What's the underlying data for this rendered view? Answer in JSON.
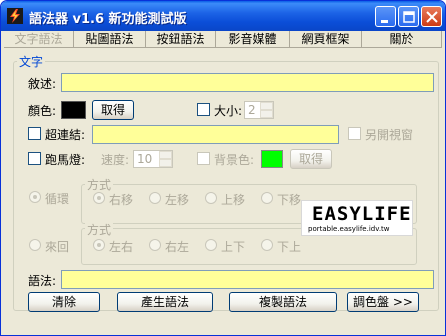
{
  "window": {
    "title": "語法器 v1.6 新功能測試版"
  },
  "menu": [
    {
      "label": "文字語法",
      "active": true
    },
    {
      "label": "貼圖語法"
    },
    {
      "label": "按鈕語法"
    },
    {
      "label": "影音媒體"
    },
    {
      "label": "網頁框架"
    },
    {
      "label": "關於"
    }
  ],
  "section": {
    "legend": "文字"
  },
  "description": {
    "label": "敘述:",
    "value": ""
  },
  "color_row": {
    "label": "顏色:",
    "swatch_color": "#000000",
    "pick_button": "取得",
    "size_label": "大小:",
    "size_value": "2"
  },
  "hyperlink": {
    "label": "超連結:",
    "value": "",
    "new_window_label": "另開視窗"
  },
  "marquee": {
    "label": "跑馬燈:",
    "speed_label": "速度:",
    "speed_value": "10",
    "bg_label": "背景色:",
    "bg_color": "#00ff00",
    "bg_button": "取得"
  },
  "loop": {
    "label": "循環",
    "group_legend": "方式",
    "options": [
      "右移",
      "左移",
      "上移",
      "下移"
    ]
  },
  "bounce": {
    "label": "來回",
    "group_legend": "方式",
    "options": [
      "左右",
      "右左",
      "上下",
      "下上"
    ]
  },
  "syntax": {
    "label": "語法:",
    "value": ""
  },
  "actions": {
    "clear": "清除",
    "generate": "產生語法",
    "copy": "複製語法",
    "palette": "調色盤 >>"
  },
  "logo": {
    "main": "EASYLIFE",
    "sub": "portable.easylife.idv.tw"
  }
}
